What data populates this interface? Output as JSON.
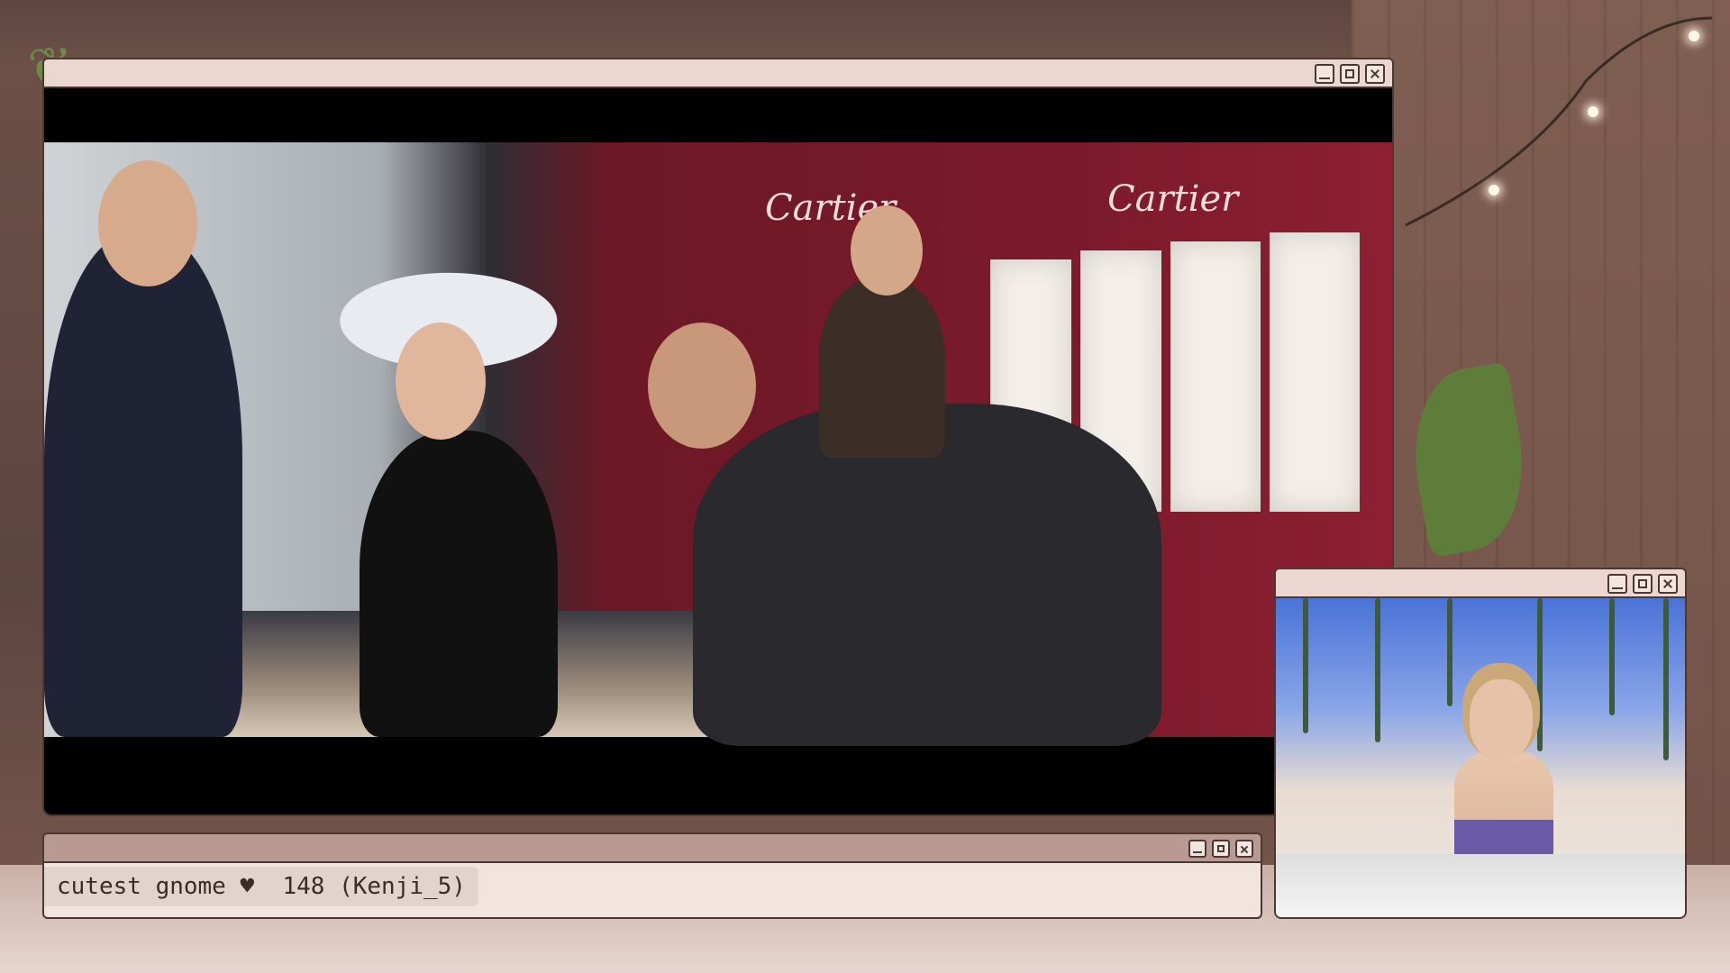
{
  "main_window": {
    "controls": {
      "minimize": "minimize",
      "maximize": "maximize",
      "close": "close"
    },
    "video": {
      "store_signs": [
        "Cartier",
        "Cartier"
      ]
    }
  },
  "chat_window": {
    "message": "cutest gnome ♥  148 (Kenji_5)"
  },
  "cam_window": {
    "controls": {
      "minimize": "minimize",
      "maximize": "maximize",
      "close": "close"
    }
  },
  "colors": {
    "chrome_border": "#4b3832",
    "titlebar": "#ecd7d0",
    "chat_titlebar": "#b99a92",
    "chat_body": "#f2e5e0",
    "background": "#6e5148"
  }
}
